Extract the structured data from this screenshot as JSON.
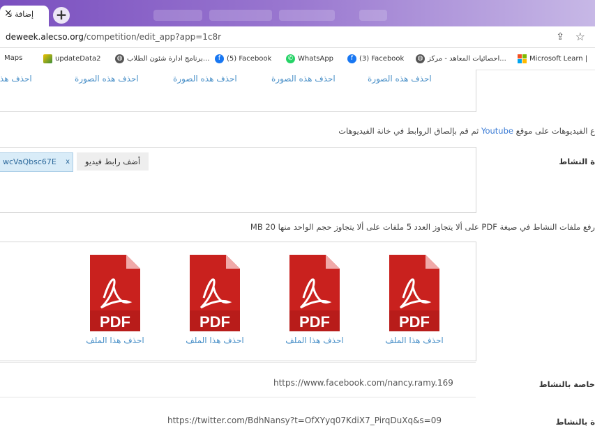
{
  "browser": {
    "tab": {
      "title": "إضافة نـ",
      "close": "×"
    },
    "new_tab": "+",
    "url_host": "deweek.alecso.org",
    "url_path": "/competition/edit_app?app=1c8r",
    "bookmarks": [
      {
        "label": "Maps",
        "icon": "none"
      },
      {
        "label": "updateData2",
        "icon": "image-icon"
      },
      {
        "label": "برنامج ادارة شئون الطلاب...",
        "icon": "globe-icon"
      },
      {
        "label": "(5) Facebook",
        "icon": "facebook-icon"
      },
      {
        "label": "WhatsApp",
        "icon": "whatsapp-icon"
      },
      {
        "label": "(3) Facebook",
        "icon": "facebook-icon"
      },
      {
        "label": "احصائيات المعاهد - مركز...",
        "icon": "globe-icon"
      },
      {
        "label": "Microsoft Learn |",
        "icon": "microsoft-icon"
      }
    ]
  },
  "images_section": {
    "delete_image_links": [
      "احذف هذه الصورة",
      "احذف هذه الصورة",
      "احذف هذه الصورة",
      "احذف هذه الصورة",
      "احذف هذه الصورة"
    ]
  },
  "videos_section": {
    "instruction_before": "ع الفيديوهات على موقع",
    "instruction_youtube": "Youtube",
    "instruction_after": "ثم قم بإلصاق الروابط في خانة الفيديوهات",
    "label": "ة النشاط",
    "chip_text": "wcVaQbsc67E",
    "chip_remove": "x",
    "add_button": "أضف رابط فيديو"
  },
  "files_section": {
    "instruction": "رفع ملفات النشاط في صيغة PDF على ألا يتجاوز العدد 5 ملفات على ألا يتجاوز حجم الواحد منها 20 MB",
    "pdf_label": "PDF",
    "delete_file_links": [
      "احذف هذا الملف",
      "احذف هذا الملف",
      "احذف هذا الملف",
      "احذف هذا الملف"
    ]
  },
  "links_section": {
    "facebook_label": "خاصة بالنشاط",
    "facebook_url": "https://www.facebook.com/nancy.ramy.169",
    "twitter_label": "ة بالنشاط",
    "twitter_url": "https://twitter.com/BdhNansy?t=OfXYyq07KdiX7_PirqDuXq&s=09"
  },
  "colors": {
    "link": "#4a90c8",
    "pdf_red": "#c9211e",
    "tab_gradient_start": "#7a4fbf"
  }
}
